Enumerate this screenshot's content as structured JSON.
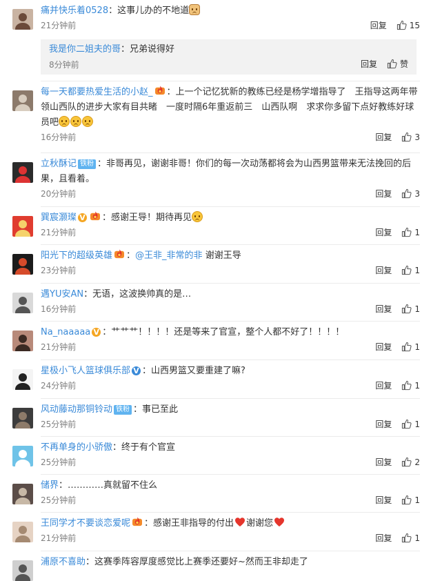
{
  "comments": [
    {
      "user": "痛并快乐着0528",
      "badges": [],
      "text": "这事儿办的不地道",
      "trail_emoji": [
        "dog-face-emoji"
      ],
      "time": "21分钟前",
      "reply": "回复",
      "likes": "15",
      "sub": {
        "user": "我是你二姐夫的哥",
        "text": "兄弟说得好",
        "time": "8分钟前",
        "reply": "回复",
        "likes": "赞"
      }
    },
    {
      "user": "每一天都要热爱生活的小赵_",
      "badges": [
        "fire"
      ],
      "text": "上一个记忆犹新的教练已经是杨学增指导了　王指导这两年带领山西队的进步大家有目共睹　一度时隔6年重返前三　山西队啊　求求你多留下点好教练好球员吧",
      "trail_emoji": [
        "sad-emoji",
        "sad-emoji",
        "sad-emoji"
      ],
      "time": "16分钟前",
      "reply": "回复",
      "likes": "3"
    },
    {
      "user": "立秋酥记",
      "badges": [
        "fan"
      ],
      "fan_label": "铁粉",
      "text": "非哥再见，谢谢非哥！你们的每一次动荡都将会为山西男篮带来无法挽回的后果，且看着。",
      "trail_emoji": [],
      "time": "20分钟前",
      "reply": "回复",
      "likes": "3"
    },
    {
      "user": "巽宸灏璨",
      "badges": [
        "v-gold",
        "fire"
      ],
      "text": "感谢王导！期待再见",
      "trail_emoji": [
        "sad-emoji"
      ],
      "time": "21分钟前",
      "reply": "回复",
      "likes": "1"
    },
    {
      "user": "阳光下的超级英雄",
      "badges": [
        "fire"
      ],
      "at": "@王非_非常的非",
      "text": "谢谢王导",
      "trail_emoji": [],
      "time": "23分钟前",
      "reply": "回复",
      "likes": "1"
    },
    {
      "user": "遇YU安AN",
      "badges": [],
      "text": "无语，这波换帅真的是…",
      "trail_emoji": [],
      "time": "16分钟前",
      "reply": "回复",
      "likes": "1"
    },
    {
      "user": "Na_naaaaa",
      "badges": [
        "v-gold"
      ],
      "text": "艹艹艹！！！！还是等来了官宣，整个人都不好了！！！！",
      "trail_emoji": [],
      "time": "21分钟前",
      "reply": "回复",
      "likes": "1"
    },
    {
      "user": "星极小飞人篮球俱乐部",
      "badges": [
        "v-blue"
      ],
      "text": "山西男篮又要重建了嘛?",
      "trail_emoji": [],
      "time": "24分钟前",
      "reply": "回复",
      "likes": "1"
    },
    {
      "user": "风动藤动那铜铃动",
      "badges": [
        "fan"
      ],
      "fan_label": "铁粉",
      "text": "事已至此",
      "trail_emoji": [],
      "time": "25分钟前",
      "reply": "回复",
      "likes": "1"
    },
    {
      "user": "不再单身的小骄傲",
      "badges": [],
      "text": "终于有个官宣",
      "trail_emoji": [],
      "time": "25分钟前",
      "reply": "回复",
      "likes": "2"
    },
    {
      "user": "储界",
      "badges": [],
      "text": "…………真就留不住么",
      "trail_emoji": [],
      "time": "25分钟前",
      "reply": "回复",
      "likes": "1"
    },
    {
      "user": "王同学才不要谈恋爱呢",
      "badges": [
        "fire"
      ],
      "text": "感谢王非指导的付出",
      "text2": "谢谢您",
      "trail_emoji": [],
      "time": "21分钟前",
      "reply": "回复",
      "likes": "1"
    },
    {
      "user": "浦原不喜助",
      "badges": [],
      "text": "这赛季阵容厚度感觉比上赛季还要好~然而王非却走了",
      "trail_emoji": [],
      "time": "",
      "reply": "",
      "likes": ""
    }
  ],
  "colors": {
    "username": "#3a8ad8",
    "fan_badge": "#5fb3f0",
    "v_gold": "#f5a623",
    "v_blue": "#3a8ad8",
    "time": "#808080",
    "heart": "#e5352c"
  }
}
